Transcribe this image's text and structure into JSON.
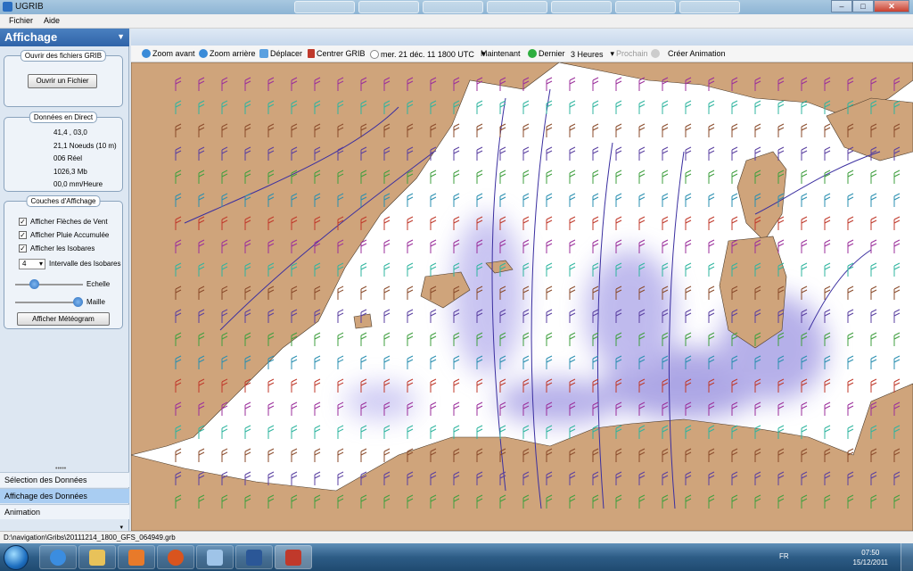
{
  "window": {
    "title": "UGRIB",
    "minimize": "–",
    "maximize": "□",
    "close": "✕"
  },
  "menu": {
    "file": "Fichier",
    "help": "Aide"
  },
  "left_panel": {
    "header": "Affichage",
    "open_files": {
      "title": "Ouvrir des fichiers GRIB",
      "button": "Ouvrir un Fichier"
    },
    "live_data": {
      "title": "Données en Direct",
      "position": "41,4 ,  03,0",
      "wind": "21,1 Noeuds (10 m)",
      "direction": "006 Réel",
      "pressure": "1026,3 Mb",
      "rain": "00,0 mm/Heure"
    },
    "layers": {
      "title": "Couches d'Affichage",
      "wind_arrows": {
        "label": "Afficher Flèches de Vent",
        "checked": true
      },
      "rain": {
        "label": "Afficher Pluie Accumulée",
        "checked": true
      },
      "isobars": {
        "label": "Afficher les Isobares",
        "checked": true
      },
      "isobar_interval_value": "4",
      "isobar_interval_label": "Intervalle des Isobares",
      "scale_label": "Echelle",
      "scale_level": 0.3,
      "mesh_label": "Maille",
      "mesh_level": 1.0,
      "meteogram_button": "Afficher Météogram"
    },
    "nav": {
      "selection": "Sélection des Données",
      "display": "Affichage des Données",
      "animation": "Animation"
    }
  },
  "toolbar": {
    "zoom_in": "Zoom avant",
    "zoom_out": "Zoom arrière",
    "move": "Déplacer",
    "center": "Centrer GRIB",
    "date": "mer. 21 déc. 11 1800 UTC",
    "now": "Maintenant",
    "last": "Dernier",
    "step": "3 Heures",
    "next": "Prochain",
    "animate": "Créer Animation"
  },
  "status": {
    "path": "D:\\navigation\\Gribs\\20111214_1800_GFS_064949.grb"
  },
  "taskbar": {
    "lang": "FR",
    "time": "07:50",
    "date": "15/12/2011"
  },
  "colors": {
    "land": "#cfa47b",
    "sea": "#ffffff",
    "rain": "#7a6fd8",
    "isobar": "#3b2fa0",
    "accent": "#2f63a8"
  }
}
